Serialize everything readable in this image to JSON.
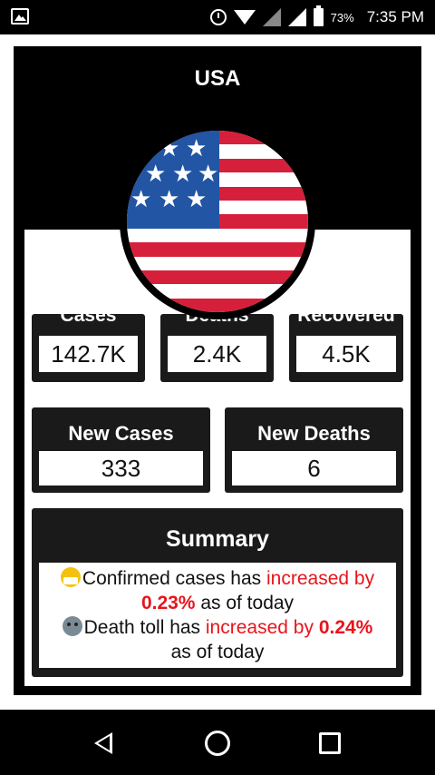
{
  "status_bar": {
    "battery_percent": "73%",
    "time": "7:35 PM",
    "icons": [
      "gallery-icon",
      "alarm-icon",
      "wifi-icon",
      "signal-icon",
      "signal-icon",
      "battery-icon"
    ]
  },
  "country": {
    "name": "USA",
    "flag_icon": "us-flag-icon"
  },
  "stats": [
    {
      "label": "Cases",
      "value": "142.7K"
    },
    {
      "label": "Deaths",
      "value": "2.4K"
    },
    {
      "label": "Recovered",
      "value": "4.5K"
    }
  ],
  "new_stats": [
    {
      "label": "New Cases",
      "value": "333"
    },
    {
      "label": "New Deaths",
      "value": "6"
    }
  ],
  "summary": {
    "title": "Summary",
    "confirmed_icon": "face-with-mask-icon",
    "confirmed_prefix": "Confirmed cases has ",
    "confirmed_trend": "increased by",
    "confirmed_pct": "0.23%",
    "confirmed_suffix": " as of today",
    "death_icon": "skull-icon",
    "death_prefix": "Death toll has ",
    "death_trend": "increased by",
    "death_pct": "0.24%",
    "death_suffix": "as of today"
  },
  "nav": {
    "icons": [
      "back-icon",
      "home-icon",
      "recents-icon"
    ]
  },
  "colors": {
    "card_bg": "#000000",
    "box_bg": "#1a1a1a",
    "highlight": "#e8141b",
    "flag_red": "#d61f3a",
    "flag_blue": "#2255a4"
  }
}
